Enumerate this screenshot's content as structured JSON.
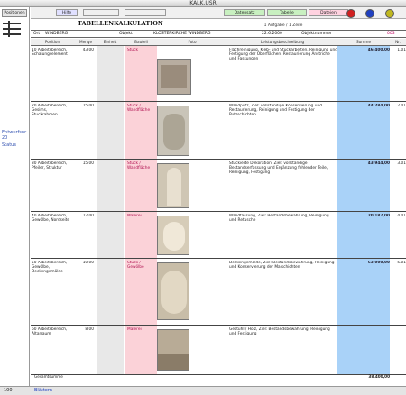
{
  "window": {
    "title": "KALK.USR"
  },
  "sidebar": {
    "header": "Positionen",
    "label1": "Entwurfsnr",
    "label2": "20",
    "label3": "Status"
  },
  "toolbar": {
    "buttons": [
      "Hilfe",
      "",
      "",
      "Datensatz",
      "Tabelle",
      "Dateien"
    ],
    "colors": {
      "dot1": "#d02020",
      "dot2": "#2040c0",
      "dot3": "#c0b820"
    }
  },
  "page": {
    "title": "TABELLENKALKULATION",
    "subtitle": "1 Aufgabe / 1 Zeile"
  },
  "info": {
    "ort_label": "Ort",
    "ort_value": "WINDBERG",
    "objekt_label": "Objekt",
    "objekt_value": "KLOSTERKIRCHE WINDBERG",
    "date": "22.6.2000",
    "objnr_label": "Objektnummer",
    "objnr_value": "003"
  },
  "columns": [
    "Position",
    "Menge",
    "Einheit",
    "Bauteil",
    "Foto",
    "Leistungsbeschreibung",
    "Summe",
    "Nr."
  ],
  "rows": [
    {
      "pos": "10 Arbeitsbereich, Schalungselement",
      "qty": "43,00",
      "unit": "",
      "kind": "Stuck",
      "desc": "Flachreinigung, Kleb- und Stuckarbeiten, Reinigung und Festigung der Oberflächen, Restaurierung Anstriche und Fassungen",
      "price": "46.400,00",
      "nr": "1.01"
    },
    {
      "pos": "20 Arbeitsbereich, Gesims, Stuckrahmen",
      "qty": "15,00",
      "unit": "",
      "kind": "Stuck / Wandfläche",
      "desc": "Wandputz, Ziel: vollständige Konservierung und Restaurierung, Reinigung und Festigung der Putzschichten",
      "price": "44.284,00",
      "nr": "2.01"
    },
    {
      "pos": "30 Arbeitsbereich, Pfeiler, Struktur",
      "qty": "15,00",
      "unit": "",
      "kind": "Stuck / Wandfläche",
      "desc": "Stuckierte Dekoration, Ziel: vollständige Bestandserfassung und Ergänzung fehlender Teile, Reinigung, Festigung",
      "price": "43.944,00",
      "nr": "3.01"
    },
    {
      "pos": "40 Arbeitsbereich, Gewölbe, Nordseite",
      "qty": "12,00",
      "unit": "",
      "kind": "Malerei",
      "desc": "Wandfassung, Ziel: Bestandsbewahrung, Reinigung und Retusche",
      "price": "20.187,00",
      "nr": "4.01"
    },
    {
      "pos": "50 Arbeitsbereich, Gewölbe, Deckengemälde",
      "qty": "10,00",
      "unit": "",
      "kind": "Stuck / Gewölbe",
      "desc": "Deckengemälde, Ziel: Bestandsbewahrung, Reinigung und Konservierung der Malschichten",
      "price": "63.000,00",
      "nr": "5.01"
    },
    {
      "pos": "60 Arbeitsbereich, Altarraum",
      "qty": "8,00",
      "unit": "",
      "kind": "Malerei",
      "desc": "Gestühl / Holz, Ziel: Bestandsbewahrung, Reinigung und Festigung",
      "price": "",
      "nr": ""
    }
  ],
  "footer": {
    "label": "Gesamtsumme",
    "total": "38.400,00"
  },
  "statusbar": {
    "zoom": "100",
    "mode": "Blättern"
  }
}
